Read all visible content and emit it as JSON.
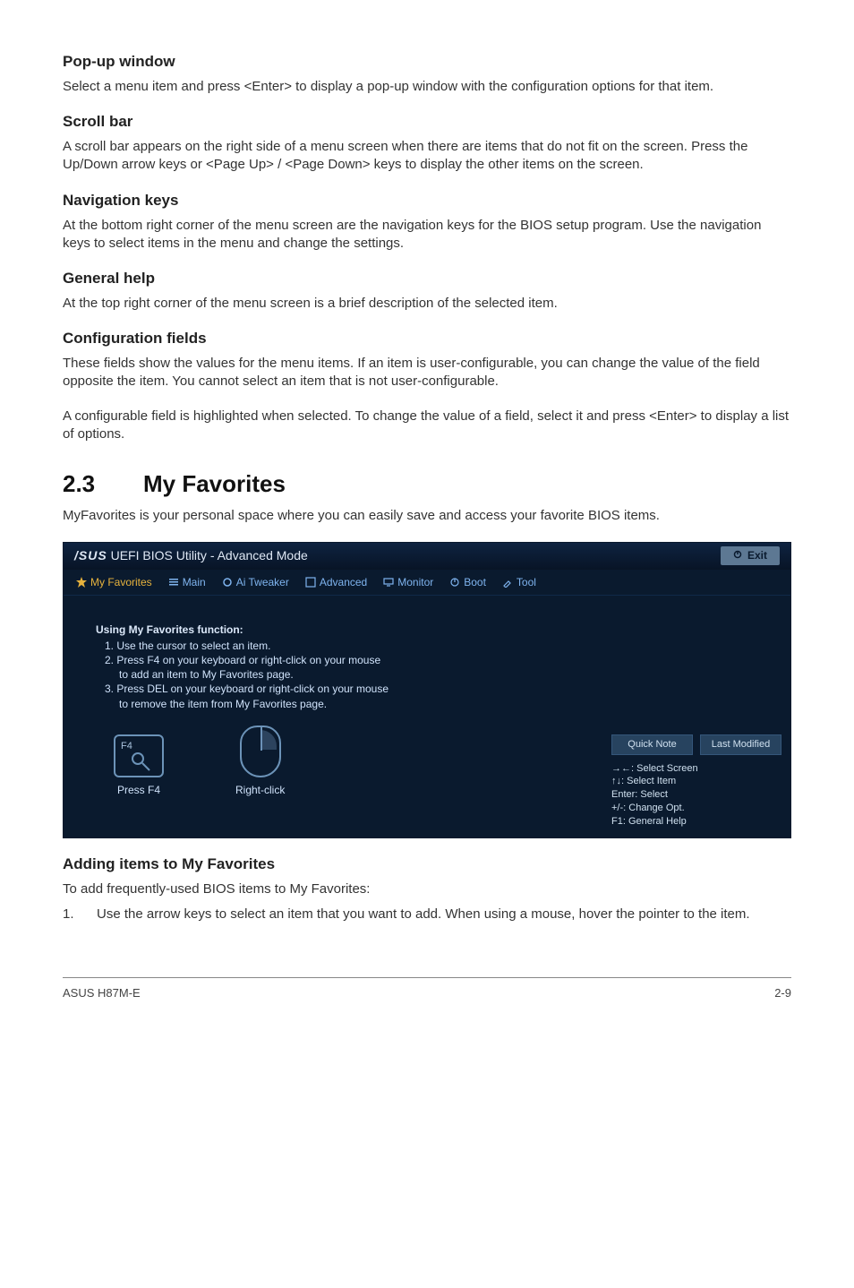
{
  "sections": {
    "popup": {
      "heading": "Pop-up window",
      "text": "Select a menu item and press <Enter> to display a pop-up window with the configuration options for that item."
    },
    "scrollbar": {
      "heading": "Scroll bar",
      "text": "A scroll bar appears on the right side of a menu screen when there are items that do not fit on the screen. Press the Up/Down arrow keys or <Page Up> / <Page Down> keys to display the other items on the screen."
    },
    "navkeys": {
      "heading": "Navigation keys",
      "text": "At the bottom right corner of the menu screen are the navigation keys for the BIOS setup program. Use the navigation keys to select items in the menu and change the settings."
    },
    "generalhelp": {
      "heading": "General help",
      "text": "At the top right corner of the menu screen is a brief description of the selected item."
    },
    "configfields": {
      "heading": "Configuration fields",
      "text1": "These fields show the values for the menu items. If an item is user-configurable, you can change the value of the field opposite the item. You cannot select an item that is not user-configurable.",
      "text2": "A configurable field is highlighted when selected. To change the value of a field, select it and press <Enter> to display a list of options."
    },
    "myfav": {
      "number": "2.3",
      "title": "My Favorites",
      "intro": "MyFavorites is your personal space where you can easily save and access your favorite BIOS items."
    },
    "adding": {
      "heading": "Adding items to My Favorites",
      "intro": "To add frequently-used BIOS items to My Favorites:",
      "step1_num": "1.",
      "step1_text": "Use the arrow keys to select an item that you want to add. When using a mouse, hover the pointer to the item."
    }
  },
  "bios": {
    "titlebar": {
      "logo": "/SUS",
      "title": "UEFI BIOS Utility - Advanced Mode",
      "exit": "Exit"
    },
    "tabs": {
      "favorites": "My Favorites",
      "main": "Main",
      "tweaker": "Ai Tweaker",
      "advanced": "Advanced",
      "monitor": "Monitor",
      "boot": "Boot",
      "tool": "Tool"
    },
    "help": {
      "header": "Using My Favorites function:",
      "li1": "1. Use the cursor to select an item.",
      "li2": "2. Press F4 on your keyboard or right-click on your mouse",
      "li2b": "to add an item to My Favorites page.",
      "li3": "3. Press DEL on your keyboard or right-click on your mouse",
      "li3b": "to remove the item from My Favorites page."
    },
    "icons": {
      "f4key": "F4",
      "press_f4": "Press F4",
      "right_click": "Right-click"
    },
    "right": {
      "quick_note": "Quick Note",
      "last_modified": "Last Modified",
      "nav1": "→←: Select Screen",
      "nav2": "↑↓: Select Item",
      "nav3": "Enter: Select",
      "nav4": "+/-: Change Opt.",
      "nav5": "F1: General Help"
    }
  },
  "footer": {
    "left": "ASUS H87M-E",
    "right": "2-9"
  }
}
